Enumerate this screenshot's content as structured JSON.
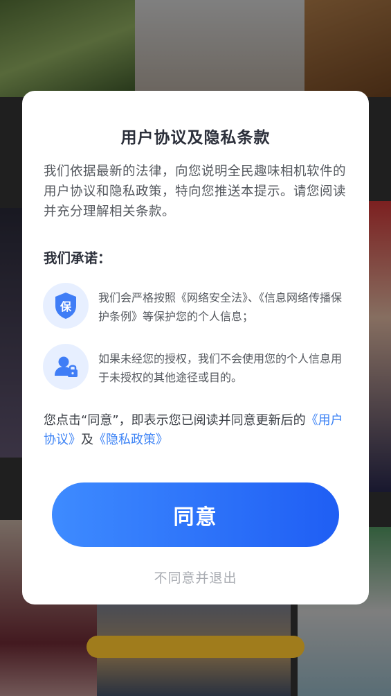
{
  "dialog": {
    "title": "用户协议及隐私条款",
    "intro": "我们依据最新的法律，向您说明全民趣味相机软件的用户协议和隐私政策，特向您推送本提示。请您阅读并充分理解相关条款。",
    "promise_heading": "我们承诺：",
    "promises": [
      {
        "icon": "shield-icon",
        "icon_char": "保",
        "text": "我们会严格按照《网络安全法》、《信息网络传播保护条例》等保护您的个人信息；"
      },
      {
        "icon": "user-lock-icon",
        "text": "如果未经您的授权，我们不会使用您的个人信息用于未授权的其他途径或目的。"
      }
    ],
    "consent_prefix": "您点击“同意”，即表示您已阅读并同意更新后的",
    "user_agreement_link": "《用户协议》",
    "consent_and": "及",
    "privacy_policy_link": "《隐私政策》",
    "agree_label": "同意",
    "disagree_label": "不同意并退出"
  },
  "colors": {
    "accent": "#2f74fb",
    "link": "#3d83f5",
    "icon_bg": "#e7efff",
    "icon_fg": "#3f7df6"
  }
}
